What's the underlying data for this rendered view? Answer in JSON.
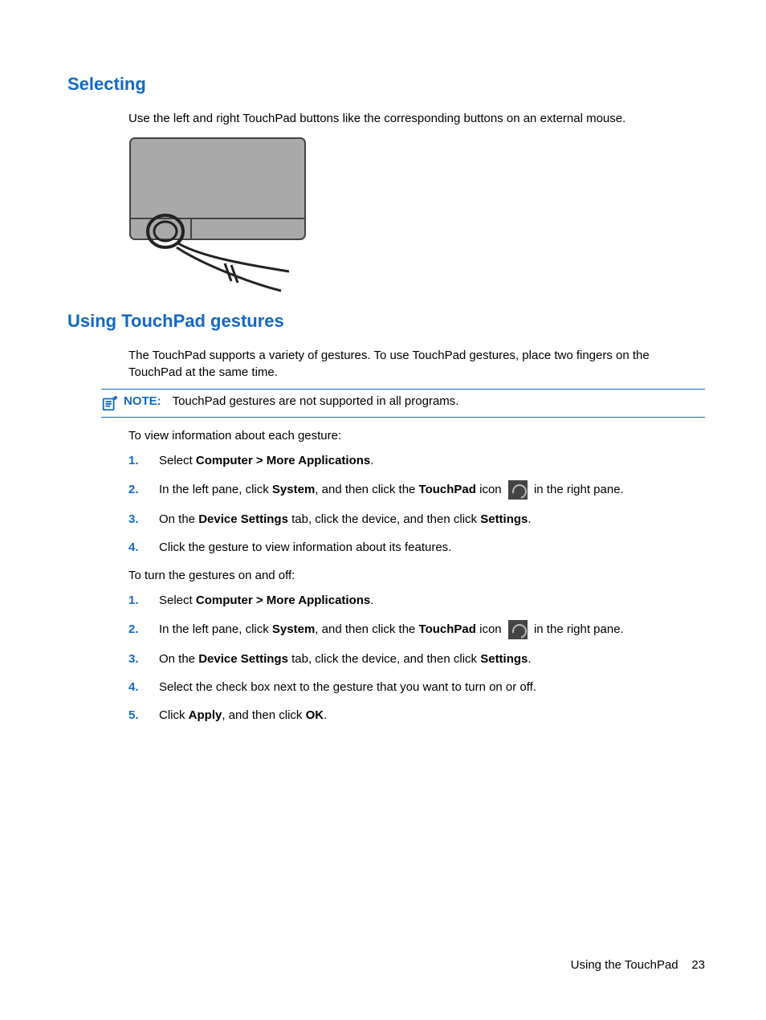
{
  "section1": {
    "heading": "Selecting",
    "intro": "Use the left and right TouchPad buttons like the corresponding buttons on an external mouse."
  },
  "section2": {
    "heading": "Using TouchPad gestures",
    "intro": "The TouchPad supports a variety of gestures. To use TouchPad gestures, place two fingers on the TouchPad at the same time.",
    "note_label": "NOTE:",
    "note_text": "TouchPad gestures are not supported in all programs.",
    "view_intro": "To view information about each gesture:",
    "toggle_intro": "To turn the gestures on and off:",
    "steps_view": {
      "s1_a": "Select ",
      "s1_b": "Computer > More Applications",
      "s1_c": ".",
      "s2_a": "In the left pane, click ",
      "s2_b": "System",
      "s2_c": ", and then click the ",
      "s2_d": "TouchPad",
      "s2_e": " icon ",
      "s2_f": " in the right pane.",
      "s3_a": "On the ",
      "s3_b": "Device Settings",
      "s3_c": " tab, click the device, and then click ",
      "s3_d": "Settings",
      "s3_e": ".",
      "s4": "Click the gesture to view information about its features."
    },
    "steps_toggle": {
      "s1_a": "Select ",
      "s1_b": "Computer > More Applications",
      "s1_c": ".",
      "s2_a": "In the left pane, click ",
      "s2_b": "System",
      "s2_c": ", and then click the ",
      "s2_d": "TouchPad",
      "s2_e": " icon ",
      "s2_f": " in the right pane.",
      "s3_a": "On the ",
      "s3_b": "Device Settings",
      "s3_c": " tab, click the device, and then click ",
      "s3_d": "Settings",
      "s3_e": ".",
      "s4": "Select the check box next to the gesture that you want to turn on or off.",
      "s5_a": "Click ",
      "s5_b": "Apply",
      "s5_c": ", and then click ",
      "s5_d": "OK",
      "s5_e": "."
    },
    "nums": {
      "n1": "1.",
      "n2": "2.",
      "n3": "3.",
      "n4": "4.",
      "n5": "5."
    }
  },
  "footer": {
    "title": "Using the TouchPad",
    "page": "23"
  }
}
